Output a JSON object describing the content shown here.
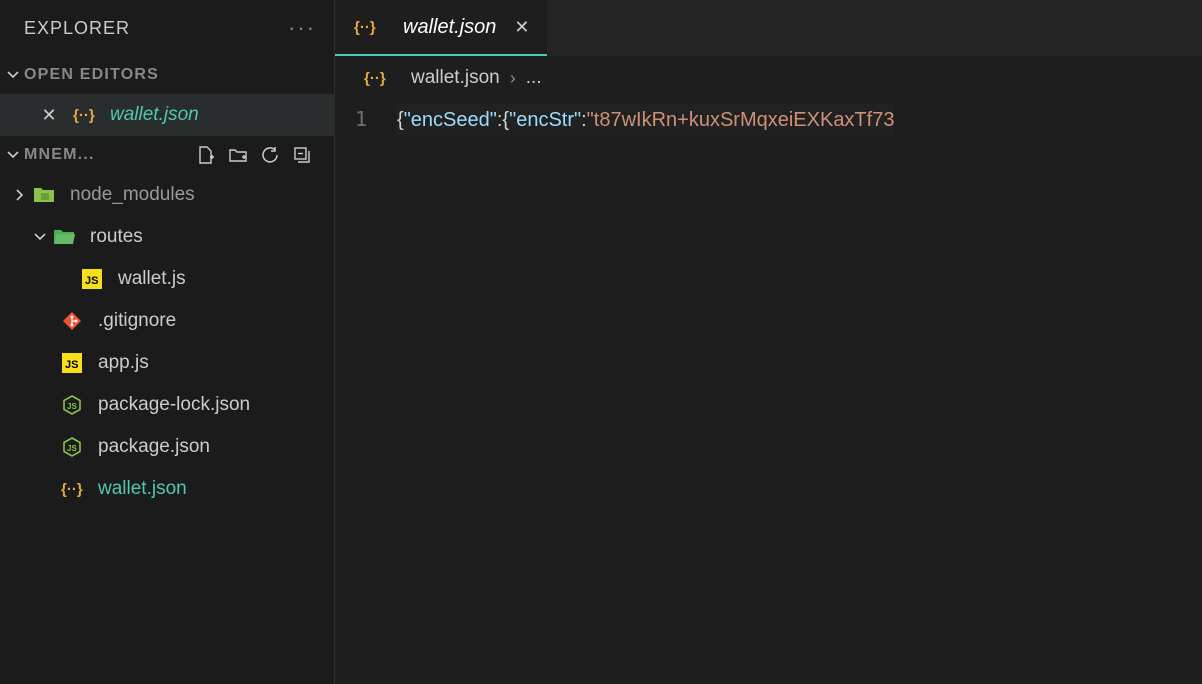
{
  "sidebar": {
    "title": "EXPLORER",
    "sections": {
      "openEditors": {
        "label": "OPEN EDITORS",
        "items": [
          {
            "name": "wallet.json",
            "active": true
          }
        ]
      },
      "workspace": {
        "label": "MNEM...",
        "tree": {
          "node_modules": {
            "type": "folder",
            "open": false,
            "label": "node_modules"
          },
          "routes": {
            "type": "folder",
            "open": true,
            "label": "routes",
            "children": [
              {
                "label": "wallet.js",
                "icon": "js"
              }
            ]
          },
          "gitignore": {
            "label": ".gitignore",
            "icon": "git"
          },
          "appjs": {
            "label": "app.js",
            "icon": "js"
          },
          "packageLock": {
            "label": "package-lock.json",
            "icon": "node"
          },
          "packageJson": {
            "label": "package.json",
            "icon": "node"
          },
          "walletJson": {
            "label": "wallet.json",
            "icon": "json",
            "active": true
          }
        }
      }
    }
  },
  "editor": {
    "tab": {
      "label": "wallet.json"
    },
    "breadcrumb": {
      "file": "wallet.json",
      "more": "..."
    },
    "lineNumber": "1",
    "code": {
      "b1": "{",
      "k1": "\"encSeed\"",
      "c1": ":",
      "b2": "{",
      "k2": "\"encStr\"",
      "c2": ":",
      "s1": "\"t87wIkRn+kuxSrMqxeiEXKaxTf73"
    }
  }
}
